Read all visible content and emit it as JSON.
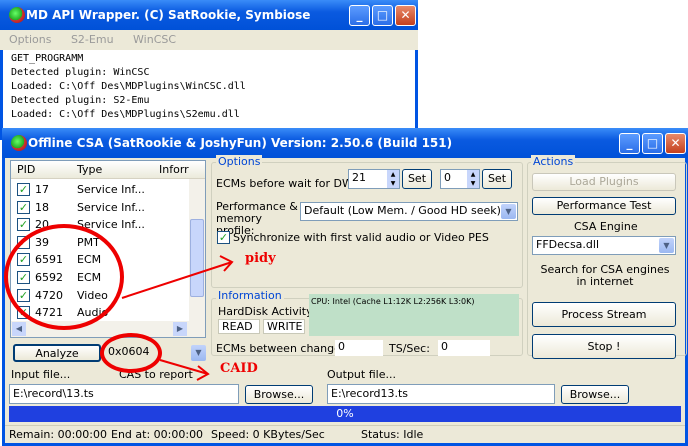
{
  "back_window": {
    "title": "MD API Wrapper. (C) SatRookie, Symbiose",
    "menu": [
      "Options",
      "S2-Emu",
      "WinCSC"
    ],
    "console_lines": [
      "GET_PROGRAMM",
      "Detected plugin: WinCSC",
      "Loaded: C:\\Off Des\\MDPlugins\\WinCSC.dll",
      "Detected plugin: S2-Emu",
      "Loaded: C:\\Off Des\\MDPlugins\\S2emu.dll"
    ]
  },
  "main_window": {
    "title": "Offline CSA (SatRookie & JoshyFun) Version: 2.50.6 (Build 151)",
    "pid_table": {
      "columns": [
        "PID",
        "Type",
        "Inforr"
      ],
      "rows": [
        {
          "pid": "17",
          "type": "Service Inf...",
          "checked": true
        },
        {
          "pid": "18",
          "type": "Service Inf...",
          "checked": true
        },
        {
          "pid": "20",
          "type": "Service Inf...",
          "checked": true
        },
        {
          "pid": "39",
          "type": "PMT",
          "checked": true
        },
        {
          "pid": "6591",
          "type": "ECM",
          "checked": true
        },
        {
          "pid": "6592",
          "type": "ECM",
          "checked": true
        },
        {
          "pid": "4720",
          "type": "Video",
          "checked": true
        },
        {
          "pid": "4721",
          "type": "Audio",
          "checked": true
        }
      ]
    },
    "analyze_label": "Analyze",
    "caid_value": "0x0604",
    "options": {
      "heading": "Options",
      "ecms_label": "ECMs before wait for DWs:",
      "ecms_value1": "21",
      "ecms_value2": "0",
      "set_label": "Set",
      "perf_label": "Performance & memory profile:",
      "perf_value": "Default (Low Mem. / Good HD seek)",
      "sync_label": "Synchronize with first valid audio or Video PES"
    },
    "information": {
      "heading": "Information",
      "hd_label": "HardDisk Activity",
      "read": "READ",
      "write": "WRITE",
      "cpu": "CPU: Intel (Cache L1:12K L2:256K L3:0K)",
      "ecm_change_label": "ECMs between change:",
      "ecm_change_value": "0",
      "ts_label": "TS/Sec:",
      "ts_value": "0"
    },
    "actions": {
      "heading": "Actions",
      "load_plugins": "Load Plugins",
      "performance_test": "Performance Test",
      "engine_heading": "CSA Engine",
      "engine_value": "FFDecsa.dll",
      "search_text": "Search for CSA engines in internet",
      "process_stream": "Process Stream",
      "stop": "Stop !"
    },
    "input_label": "Input file...",
    "cas_label": "CAS to report",
    "output_label": "Output file...",
    "input_value": "E:\\record\\13.ts",
    "output_value": "E:\\record13.ts",
    "browse": "Browse...",
    "progress": "0%",
    "progress_value": 0,
    "status": {
      "remain": "Remain: 00:00:00",
      "end": "End at: 00:00:00",
      "speed": "Speed: 0 KBytes/Sec",
      "status": "Status: Idle"
    }
  },
  "annotations": {
    "pidy": "pidy",
    "caid": "CAID"
  },
  "colors": {
    "titlebar": "#0a5ae0",
    "progress": "#1f40e0",
    "info_panel": "#bfe0c8",
    "annotation": "#e00000"
  }
}
